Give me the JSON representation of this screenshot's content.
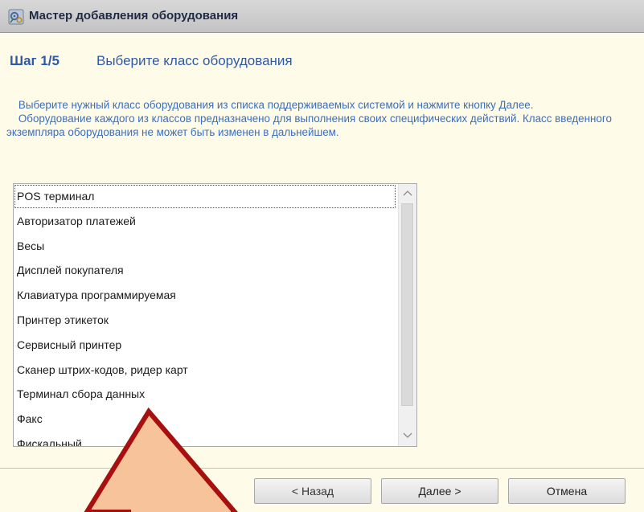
{
  "window": {
    "title": "Мастер добавления оборудования",
    "icon": "gear-wizard-icon"
  },
  "step": {
    "label": "Шаг 1/5",
    "title": "Выберите класс оборудования"
  },
  "description": {
    "paragraph1": "    Выберите нужный класс оборудования из списка поддерживаемых системой и нажмите кнопку Далее.",
    "paragraph2": "    Оборудование каждого из классов предназначено для выполнения своих специфических действий. Класс введенного экземпляра оборудования не может быть изменен в дальнейшем."
  },
  "equipment_list": {
    "items": [
      "POS терминал",
      "Авторизатор платежей",
      "Весы",
      "Дисплей покупателя",
      "Клавиатура программируемая",
      "Принтер этикеток",
      "Сервисный принтер",
      "Сканер штрих-кодов, ридер карт",
      "Терминал сбора данных",
      "Факс",
      "Фискальный"
    ],
    "selected": "POS терминал"
  },
  "buttons": {
    "back": "< Назад",
    "next": "Далее >",
    "cancel": "Отмена"
  },
  "colors": {
    "background": "#fffbe9",
    "accent": "#2e5aa8",
    "description_text": "#3b6fbd",
    "annotation_fill": "#f7c39b",
    "annotation_stroke": "#a80f0f"
  },
  "annotation": {
    "shape": "pointer-arrow",
    "direction": "up"
  }
}
